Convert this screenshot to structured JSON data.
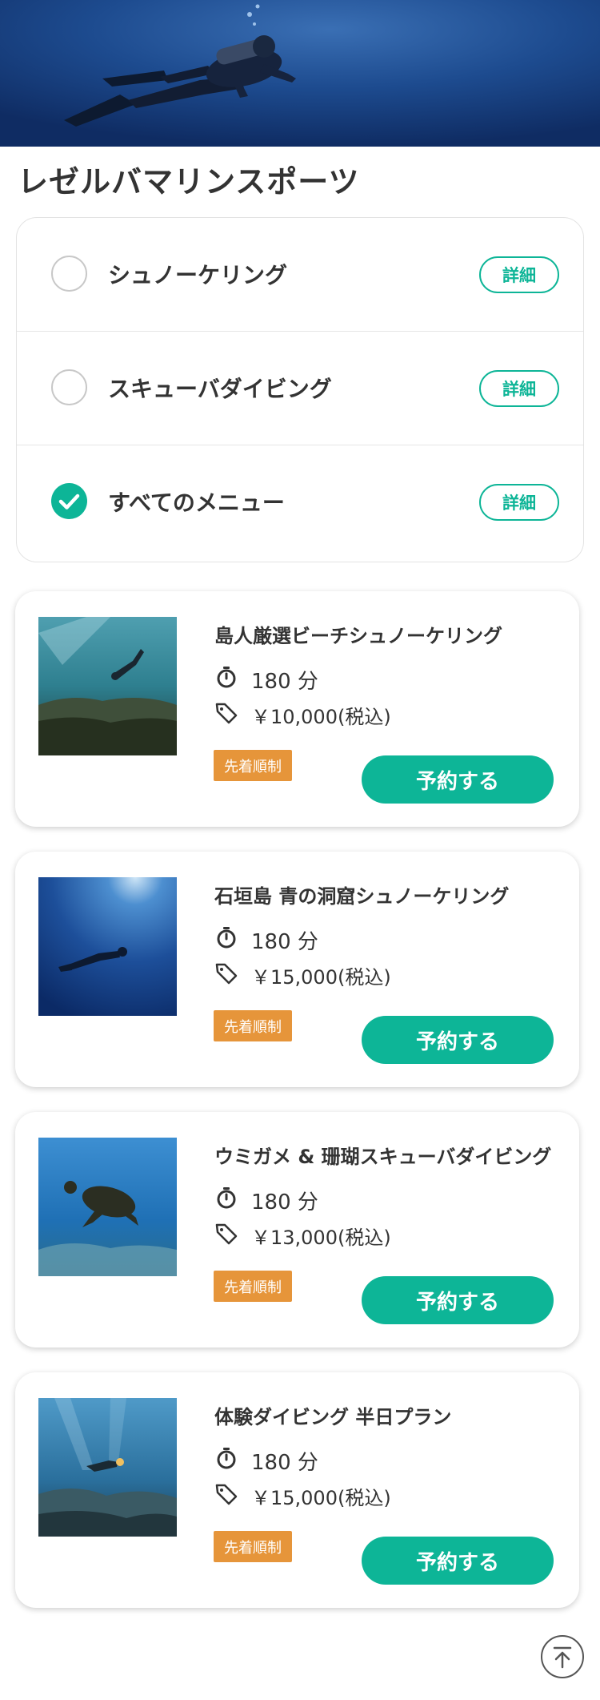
{
  "shop": {
    "title": "レゼルバマリンスポーツ"
  },
  "menu": {
    "items": [
      {
        "label": "シュノーケリング",
        "detail_label": "詳細",
        "checked": false
      },
      {
        "label": "スキューバダイビング",
        "detail_label": "詳細",
        "checked": false
      },
      {
        "label": "すべてのメニュー",
        "detail_label": "詳細",
        "checked": true
      }
    ]
  },
  "tours": [
    {
      "title": "島人厳選ビーチシュノーケリング",
      "duration": "180 分",
      "price": "￥10,000(税込)",
      "badge": "先着順制",
      "reserve_label": "予約する"
    },
    {
      "title": "石垣島  青の洞窟シュノーケリング",
      "duration": "180 分",
      "price": "￥15,000(税込)",
      "badge": "先着順制",
      "reserve_label": "予約する"
    },
    {
      "title": "ウミガメ & 珊瑚スキューバダイビング",
      "duration": "180 分",
      "price": "￥13,000(税込)",
      "badge": "先着順制",
      "reserve_label": "予約する"
    },
    {
      "title": "体験ダイビング  半日プラン",
      "duration": "180 分",
      "price": "￥15,000(税込)",
      "badge": "先着順制",
      "reserve_label": "予約する"
    }
  ],
  "colors": {
    "accent": "#0db597",
    "badge": "#e6953a",
    "text": "#333333"
  },
  "icons": {
    "timer": "stopwatch-icon",
    "price": "price-tag-icon",
    "check": "checkmark-icon",
    "scroll_top": "arrow-up-to-top-icon"
  }
}
